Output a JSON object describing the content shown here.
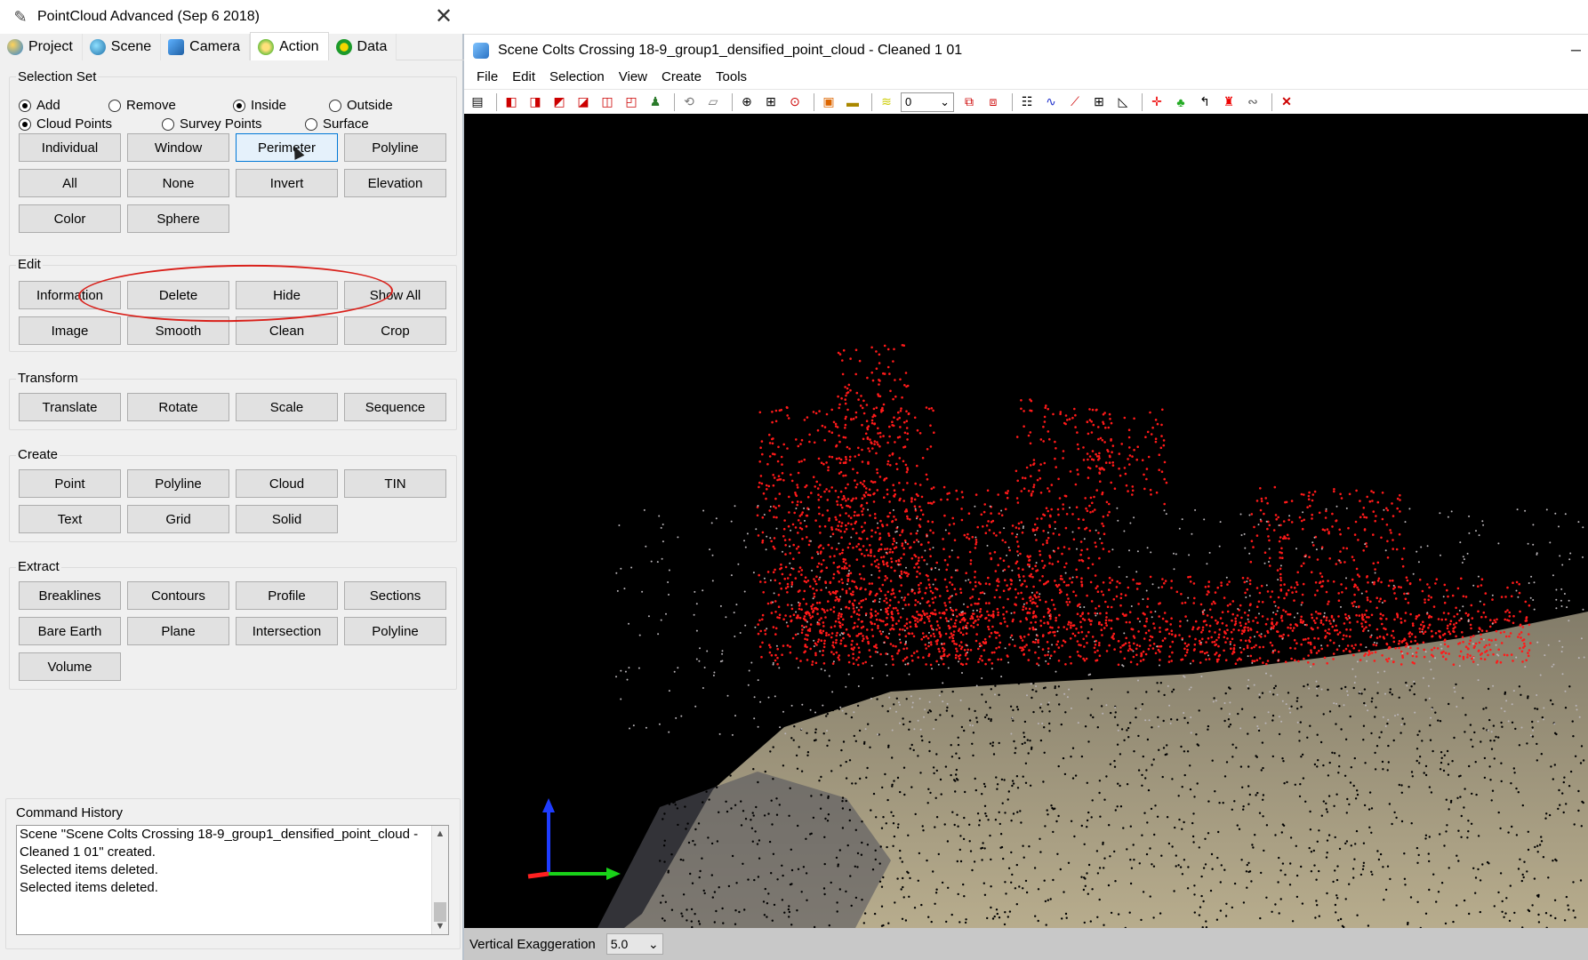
{
  "left_panel": {
    "title": "PointCloud Advanced (Sep  6 2018)",
    "close_glyph": "✕",
    "tabs": [
      {
        "label": "Project",
        "icon": "globe-icon"
      },
      {
        "label": "Scene",
        "icon": "scene-icon"
      },
      {
        "label": "Camera",
        "icon": "camera-icon"
      },
      {
        "label": "Action",
        "icon": "action-icon",
        "active": true
      },
      {
        "label": "Data",
        "icon": "data-icon"
      }
    ],
    "selection_set": {
      "label": "Selection Set",
      "radios": [
        {
          "label": "Add",
          "checked": true
        },
        {
          "label": "Remove",
          "checked": false
        },
        {
          "label": "Inside",
          "checked": true
        },
        {
          "label": "Outside",
          "checked": false
        },
        {
          "label": "Cloud Points",
          "checked": true
        },
        {
          "label": "Survey Points",
          "checked": false
        },
        {
          "label": "Surface",
          "checked": false
        }
      ],
      "buttons": [
        "Individual",
        "Window",
        "Perimeter",
        "Polyline",
        "All",
        "None",
        "Invert",
        "Elevation",
        "Color",
        "Sphere"
      ]
    },
    "edit": {
      "label": "Edit",
      "buttons": [
        "Information",
        "Delete",
        "Hide",
        "Show All",
        "Image",
        "Smooth",
        "Clean",
        "Crop"
      ]
    },
    "transform": {
      "label": "Transform",
      "buttons": [
        "Translate",
        "Rotate",
        "Scale",
        "Sequence"
      ]
    },
    "create": {
      "label": "Create",
      "buttons": [
        "Point",
        "Polyline",
        "Cloud",
        "TIN",
        "Text",
        "Grid",
        "Solid"
      ]
    },
    "extract": {
      "label": "Extract",
      "buttons": [
        "Breaklines",
        "Contours",
        "Profile",
        "Sections",
        "Bare Earth",
        "Plane",
        "Intersection",
        "Polyline",
        "Volume"
      ]
    },
    "command_history": {
      "label": "Command History",
      "lines": [
        "Scene \"Scene Colts Crossing 18-9_group1_densified_point_cloud -",
        "Cleaned 1 01\" created.",
        "Selected items deleted.",
        "Selected items deleted."
      ]
    }
  },
  "scene_window": {
    "title": "Scene Colts Crossing 18-9_group1_densified_point_cloud - Cleaned 1 01",
    "minimize_glyph": "–",
    "menu": [
      "File",
      "Edit",
      "Selection",
      "View",
      "Create",
      "Tools"
    ],
    "toolbar_layer_value": "0",
    "status_label": "Vertical Exaggeration",
    "vertical_exaggeration": "5.0"
  },
  "colors": {
    "selected_points": "#ff1a1a",
    "ground_points": "#c8b99a",
    "annotation_oval": "#d9201a",
    "viewport_bg": "#000000"
  }
}
